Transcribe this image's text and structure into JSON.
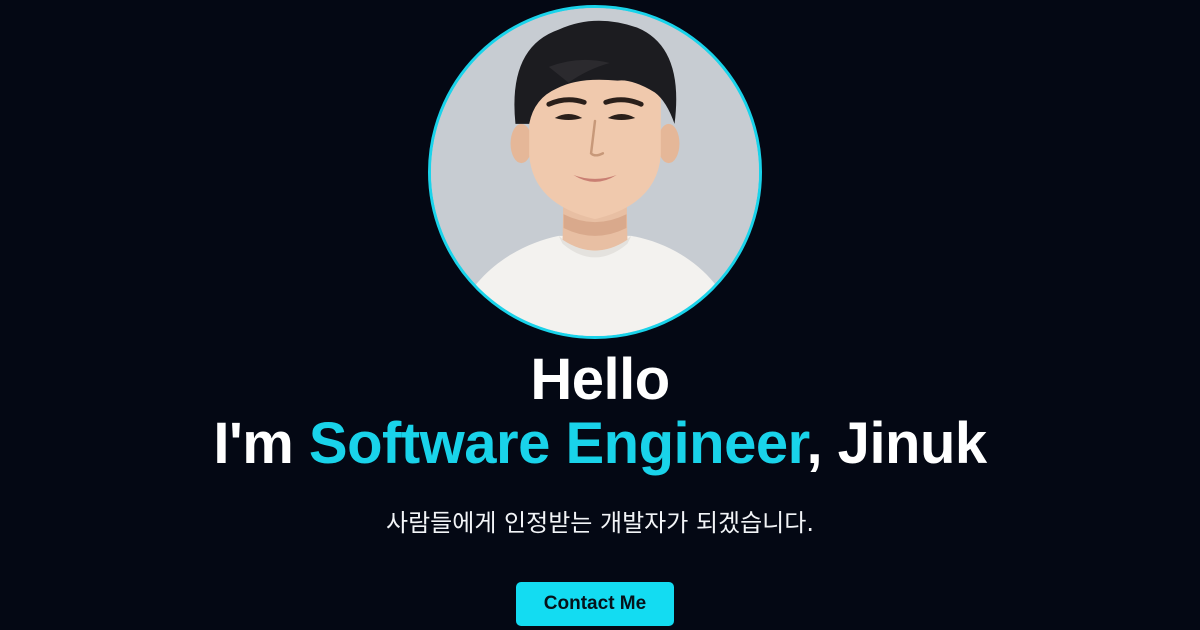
{
  "hero": {
    "greeting": "Hello",
    "intro_prefix": "I'm ",
    "role": "Software Engineer",
    "intro_suffix": ", Jinuk",
    "tagline": "사람들에게 인정받는 개발자가 되겠습니다.",
    "cta_label": "Contact Me"
  },
  "colors": {
    "background": "#040814",
    "accent": "#19d3ea",
    "button": "#13dcf2"
  }
}
